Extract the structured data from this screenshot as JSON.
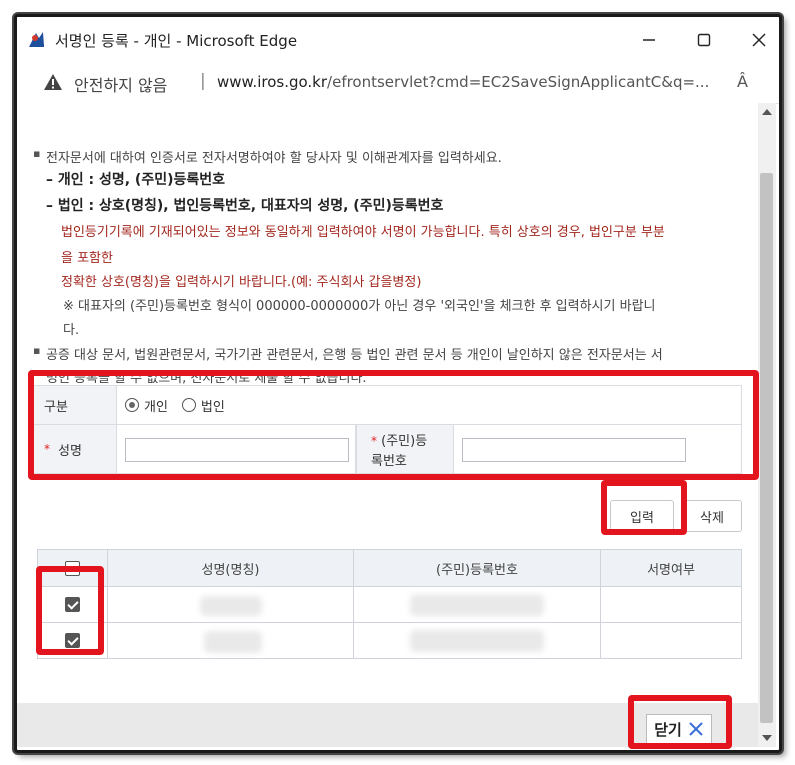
{
  "window": {
    "title": "서명인 등록 - 개인 - Microsoft Edge",
    "minimize": "—",
    "maximize": "☐",
    "close": "✕"
  },
  "addressbar": {
    "security_label": "안전하지 않음",
    "separator": "|",
    "url_host": "www.iros.go.kr",
    "url_path": "/efrontservlet?cmd=EC2SaveSignApplicantC&q=...",
    "reader_icon": "Â"
  },
  "notice": {
    "line1": "전자문서에 대하여 인증서로 전자서명하여야 할 당사자 및 이해관계자를 입력하세요.",
    "individual": "– 개인 : 성명, (주민)등록번호",
    "corporate": "– 법인 : 상호(명칭), 법인등록번호, 대표자의 성명, (주민)등록번호",
    "red1a": "법인등기기록에 기재되어있는 정보와 동일하게 입력하여야 서명이 가능합니다. 특히 상호의 경우, 법인구분 부분",
    "red1b": "을 포함한",
    "red2": "정확한 상호(명칭)을 입력하시기 바랍니다.(예: 주식회사 갑을병정)",
    "note_a": "※ 대표자의 (주민)등록번호 형식이 000000-0000000가 아닌 경우 '외국인'을 체크한 후 입력하시기 바랍니",
    "note_b": "다.",
    "line2a": "공증 대상 문서, 법원관련문서, 국가기관 관련문서, 은행 등 법인 관련 문서 등 개인이 날인하지 않은 전자문서는 서",
    "line2b": "명인 등록을 할 수 없으며, 전자문서로 제출 할 수 없습니다."
  },
  "form": {
    "type_label": "구분",
    "type_options": [
      "개인",
      "법인"
    ],
    "type_selected": "개인",
    "name_label": "성명",
    "name_value": "",
    "regno_label_1": "(주민)등",
    "regno_label_2": "록번호",
    "regno_value": "",
    "required_mark": "*"
  },
  "buttons": {
    "input": "입력",
    "delete": "삭제",
    "close": "닫기"
  },
  "grid": {
    "columns": [
      "성명(명칭)",
      "(주민)등록번호",
      "서명여부"
    ],
    "header_checked": false,
    "rows": [
      {
        "checked": true,
        "name": "",
        "regno": "",
        "signed": ""
      },
      {
        "checked": true,
        "name": "",
        "regno": "",
        "signed": ""
      }
    ]
  },
  "colors": {
    "highlight": "#e3141e",
    "notice_red": "#a3281f",
    "header_bg": "#eef1f5"
  }
}
